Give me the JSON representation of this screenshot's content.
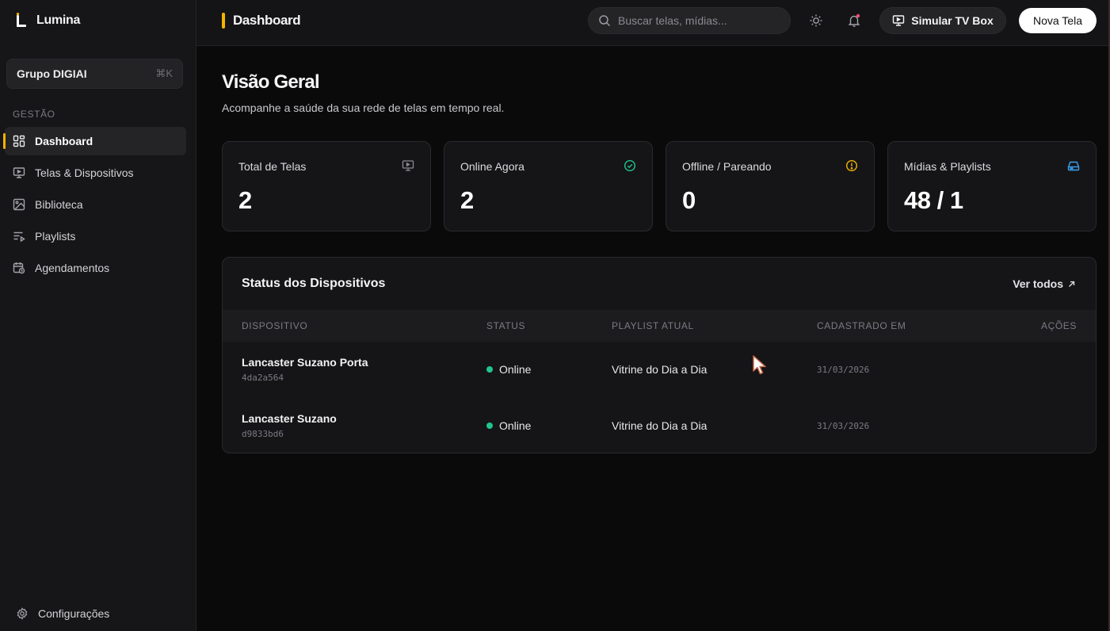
{
  "app": {
    "name": "Lumina"
  },
  "sidebar": {
    "org": {
      "name": "Grupo DIGIAI",
      "shortcut": "⌘K"
    },
    "section_label": "GESTÃO",
    "items": [
      {
        "label": "Dashboard",
        "icon": "grid-icon",
        "active": true
      },
      {
        "label": "Telas & Dispositivos",
        "icon": "monitor-icon",
        "active": false
      },
      {
        "label": "Biblioteca",
        "icon": "image-icon",
        "active": false
      },
      {
        "label": "Playlists",
        "icon": "playlist-icon",
        "active": false
      },
      {
        "label": "Agendamentos",
        "icon": "calendar-clock-icon",
        "active": false
      }
    ],
    "settings_label": "Configurações"
  },
  "topbar": {
    "title": "Dashboard",
    "search_placeholder": "Buscar telas, mídias...",
    "simulate_label": "Simular TV Box",
    "new_screen_label": "Nova Tela"
  },
  "page": {
    "title": "Visão Geral",
    "subtitle": "Acompanhe a saúde da sua rede de telas em tempo real."
  },
  "stats": [
    {
      "label": "Total de Telas",
      "value": "2",
      "icon": "monitor-play-icon",
      "color": "#8a8a92"
    },
    {
      "label": "Online Agora",
      "value": "2",
      "icon": "check-circle-icon",
      "color": "#22c58b"
    },
    {
      "label": "Offline / Pareando",
      "value": "0",
      "icon": "alert-circle-icon",
      "color": "#f5b400"
    },
    {
      "label": "Mídias & Playlists",
      "value": "48 / 1",
      "icon": "hard-drive-icon",
      "color": "#3ba0f0"
    }
  ],
  "devices": {
    "title": "Status dos Dispositivos",
    "view_all": "Ver todos",
    "columns": [
      "DISPOSITIVO",
      "STATUS",
      "PLAYLIST ATUAL",
      "CADASTRADO EM",
      "AÇÕES"
    ],
    "rows": [
      {
        "name": "Lancaster Suzano Porta",
        "id": "4da2a564",
        "status": "Online",
        "playlist": "Vitrine do Dia a Dia",
        "created": "31/03/2026"
      },
      {
        "name": "Lancaster Suzano",
        "id": "d9833bd6",
        "status": "Online",
        "playlist": "Vitrine do Dia a Dia",
        "created": "31/03/2026"
      }
    ]
  },
  "colors": {
    "accent": "#f5b400",
    "online": "#22c58b",
    "background": "#0a0a0b"
  }
}
